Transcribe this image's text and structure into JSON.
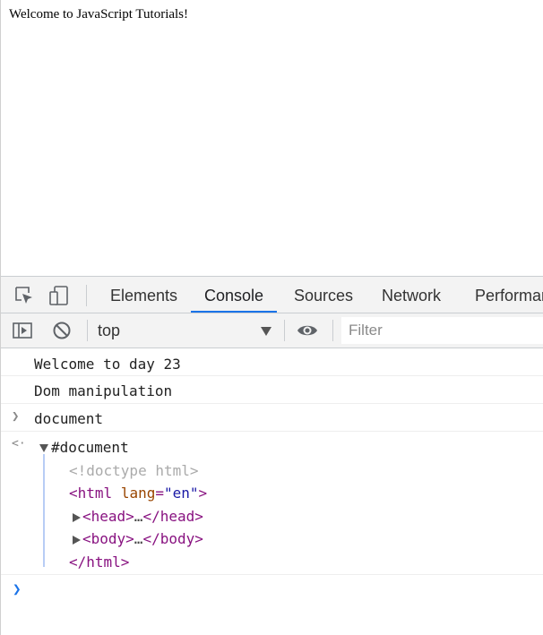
{
  "page": {
    "heading": "Welcome to JavaScript Tutorials!"
  },
  "devtools": {
    "tabs": [
      {
        "label": "Elements"
      },
      {
        "label": "Console"
      },
      {
        "label": "Sources"
      },
      {
        "label": "Network"
      },
      {
        "label": "Performan"
      }
    ],
    "active_tab": "Console",
    "accent_color": "#1a73e8",
    "icons": [
      "inspect-element-icon",
      "device-toggle-icon",
      "sidebar-toggle-icon",
      "clear-console-icon",
      "eye-icon"
    ],
    "toolbar": {
      "context": "top",
      "filter_placeholder": "Filter"
    },
    "console": {
      "logs": [
        "Welcome to day 23",
        "Dom manipulation"
      ],
      "input": "document",
      "result": {
        "root": "#document",
        "doctype": "<!doctype html>",
        "html_open_tag": "<html",
        "html_attr_name": "lang",
        "html_attr_eq": "=",
        "html_attr_value": "\"en\"",
        "html_open_close": ">",
        "head_open": "<head>",
        "head_close": "</head>",
        "body_open": "<body>",
        "body_close": "</body>",
        "ellipsis": "…",
        "html_close": "</html>"
      }
    }
  }
}
